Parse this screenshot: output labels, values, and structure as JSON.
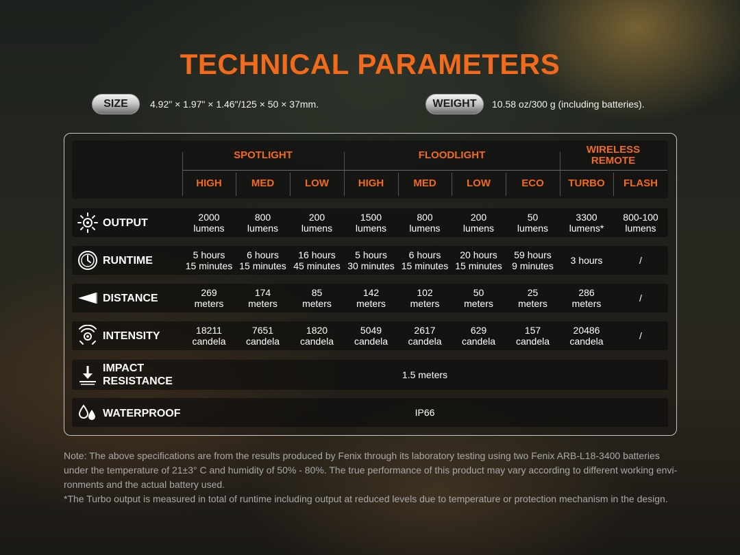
{
  "title": "TECHNICAL PARAMETERS",
  "size": {
    "label": "SIZE",
    "value": "4.92\" × 1.97\" × 1.46\"/125 × 50 × 37mm."
  },
  "weight": {
    "label": "WEIGHT",
    "value": "10.58 oz/300 g (including batteries)."
  },
  "groups": [
    "SPOTLIGHT",
    "FLOODLIGHT",
    "WIRELESS REMOTE"
  ],
  "modes": [
    "HIGH",
    "MED",
    "LOW",
    "HIGH",
    "MED",
    "LOW",
    "ECO",
    "TURBO",
    "FLASH"
  ],
  "rows": {
    "output": {
      "label": "OUTPUT",
      "icon": "sun-icon",
      "cells": [
        [
          "2000",
          "lumens"
        ],
        [
          "800",
          "lumens"
        ],
        [
          "200",
          "lumens"
        ],
        [
          "1500",
          "lumens"
        ],
        [
          "800",
          "lumens"
        ],
        [
          "200",
          "lumens"
        ],
        [
          "50",
          "lumens"
        ],
        [
          "3300",
          "lumens*"
        ],
        [
          "800-100",
          "lumens"
        ]
      ]
    },
    "runtime": {
      "label": "RUNTIME",
      "icon": "clock-icon",
      "cells": [
        [
          "5 hours",
          "15 minutes"
        ],
        [
          "6 hours",
          "15 minutes"
        ],
        [
          "16 hours",
          "45 minutes"
        ],
        [
          "5 hours",
          "30 minutes"
        ],
        [
          "6 hours",
          "15 minutes"
        ],
        [
          "20 hours",
          "15 minutes"
        ],
        [
          "59 hours",
          "9 minutes"
        ],
        [
          "3 hours",
          ""
        ],
        [
          "/",
          ""
        ]
      ]
    },
    "distance": {
      "label": "DISTANCE",
      "icon": "beam-icon",
      "cells": [
        [
          "269",
          "meters"
        ],
        [
          "174",
          "meters"
        ],
        [
          "85",
          "meters"
        ],
        [
          "142",
          "meters"
        ],
        [
          "102",
          "meters"
        ],
        [
          "50",
          "meters"
        ],
        [
          "25",
          "meters"
        ],
        [
          "286",
          "meters"
        ],
        [
          "/",
          ""
        ]
      ]
    },
    "intensity": {
      "label": "INTENSITY",
      "icon": "intensity-icon",
      "cells": [
        [
          "18211",
          "candela"
        ],
        [
          "7651",
          "candela"
        ],
        [
          "1820",
          "candela"
        ],
        [
          "5049",
          "candela"
        ],
        [
          "2617",
          "candela"
        ],
        [
          "629",
          "candela"
        ],
        [
          "157",
          "candela"
        ],
        [
          "20486",
          "candela"
        ],
        [
          "/",
          ""
        ]
      ]
    },
    "impact": {
      "label_1": "IMPACT",
      "label_2": "RESISTANCE",
      "icon": "impact-arrow-icon",
      "value": "1.5 meters"
    },
    "waterproof": {
      "label": "WATERPROOF",
      "icon": "water-drops-icon",
      "value": "IP66"
    }
  },
  "notes": [
    "Note: The above specifications are from the results produced by Fenix through its laboratory testing using two Fenix ARB-L18-3400 batteries",
    "under the temperature of 21±3° C and humidity of 50% - 80%. The true performance of this product may vary according to different working envi-",
    "ronments and the actual battery used.",
    "*The Turbo output is measured in total of runtime including output at reduced levels due to temperature or protection mechanism in the design."
  ]
}
